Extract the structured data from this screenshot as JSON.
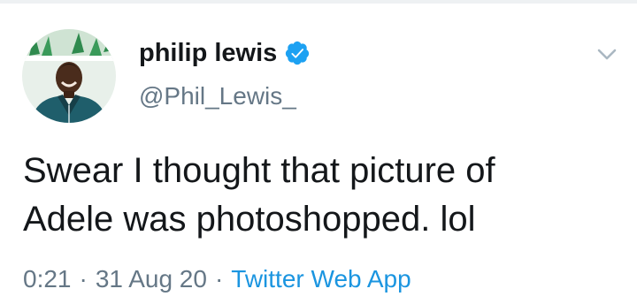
{
  "tweet": {
    "author": {
      "display_name": "philip lewis",
      "handle": "@Phil_Lewis_",
      "verified": true,
      "avatar_icon": "profile-photo"
    },
    "text_lines": [
      "Swear I thought that picture of",
      "Adele was photoshopped. lol"
    ],
    "time": "0:21",
    "separator": "·",
    "date": "31 Aug 20",
    "source": "Twitter Web App"
  },
  "icons": {
    "verified": "verified-badge-icon",
    "menu": "chevron-down-icon"
  },
  "colors": {
    "text": "#14171a",
    "secondary": "#657786",
    "link": "#1b95e0",
    "verified": "#1da1f2"
  }
}
